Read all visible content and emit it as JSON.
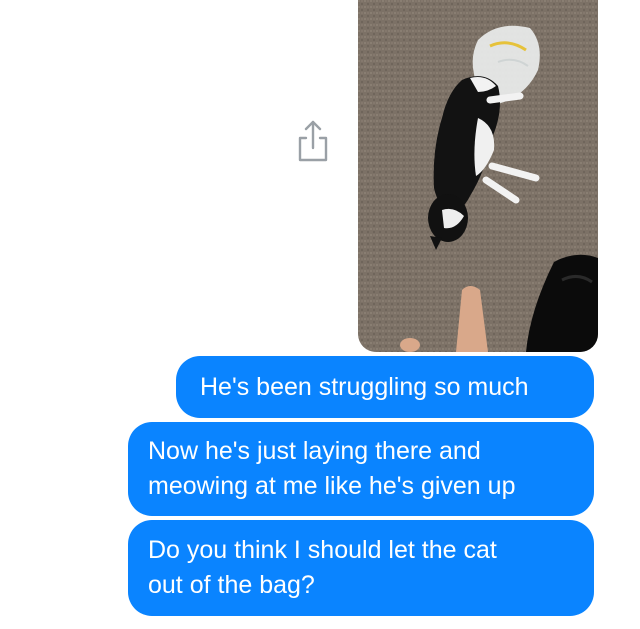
{
  "messages": [
    {
      "text": "He's been struggling so much"
    },
    {
      "text": "Now he's just laying there and\nmeowing at me like he's given up"
    },
    {
      "text": "Do you think I should let the cat\nout of the bag?"
    }
  ],
  "colors": {
    "bubble": "#0a84ff",
    "bubble_text": "#ffffff",
    "background": "#ffffff",
    "share_icon": "#9aa0a6"
  },
  "icons": {
    "share": "share-icon"
  }
}
